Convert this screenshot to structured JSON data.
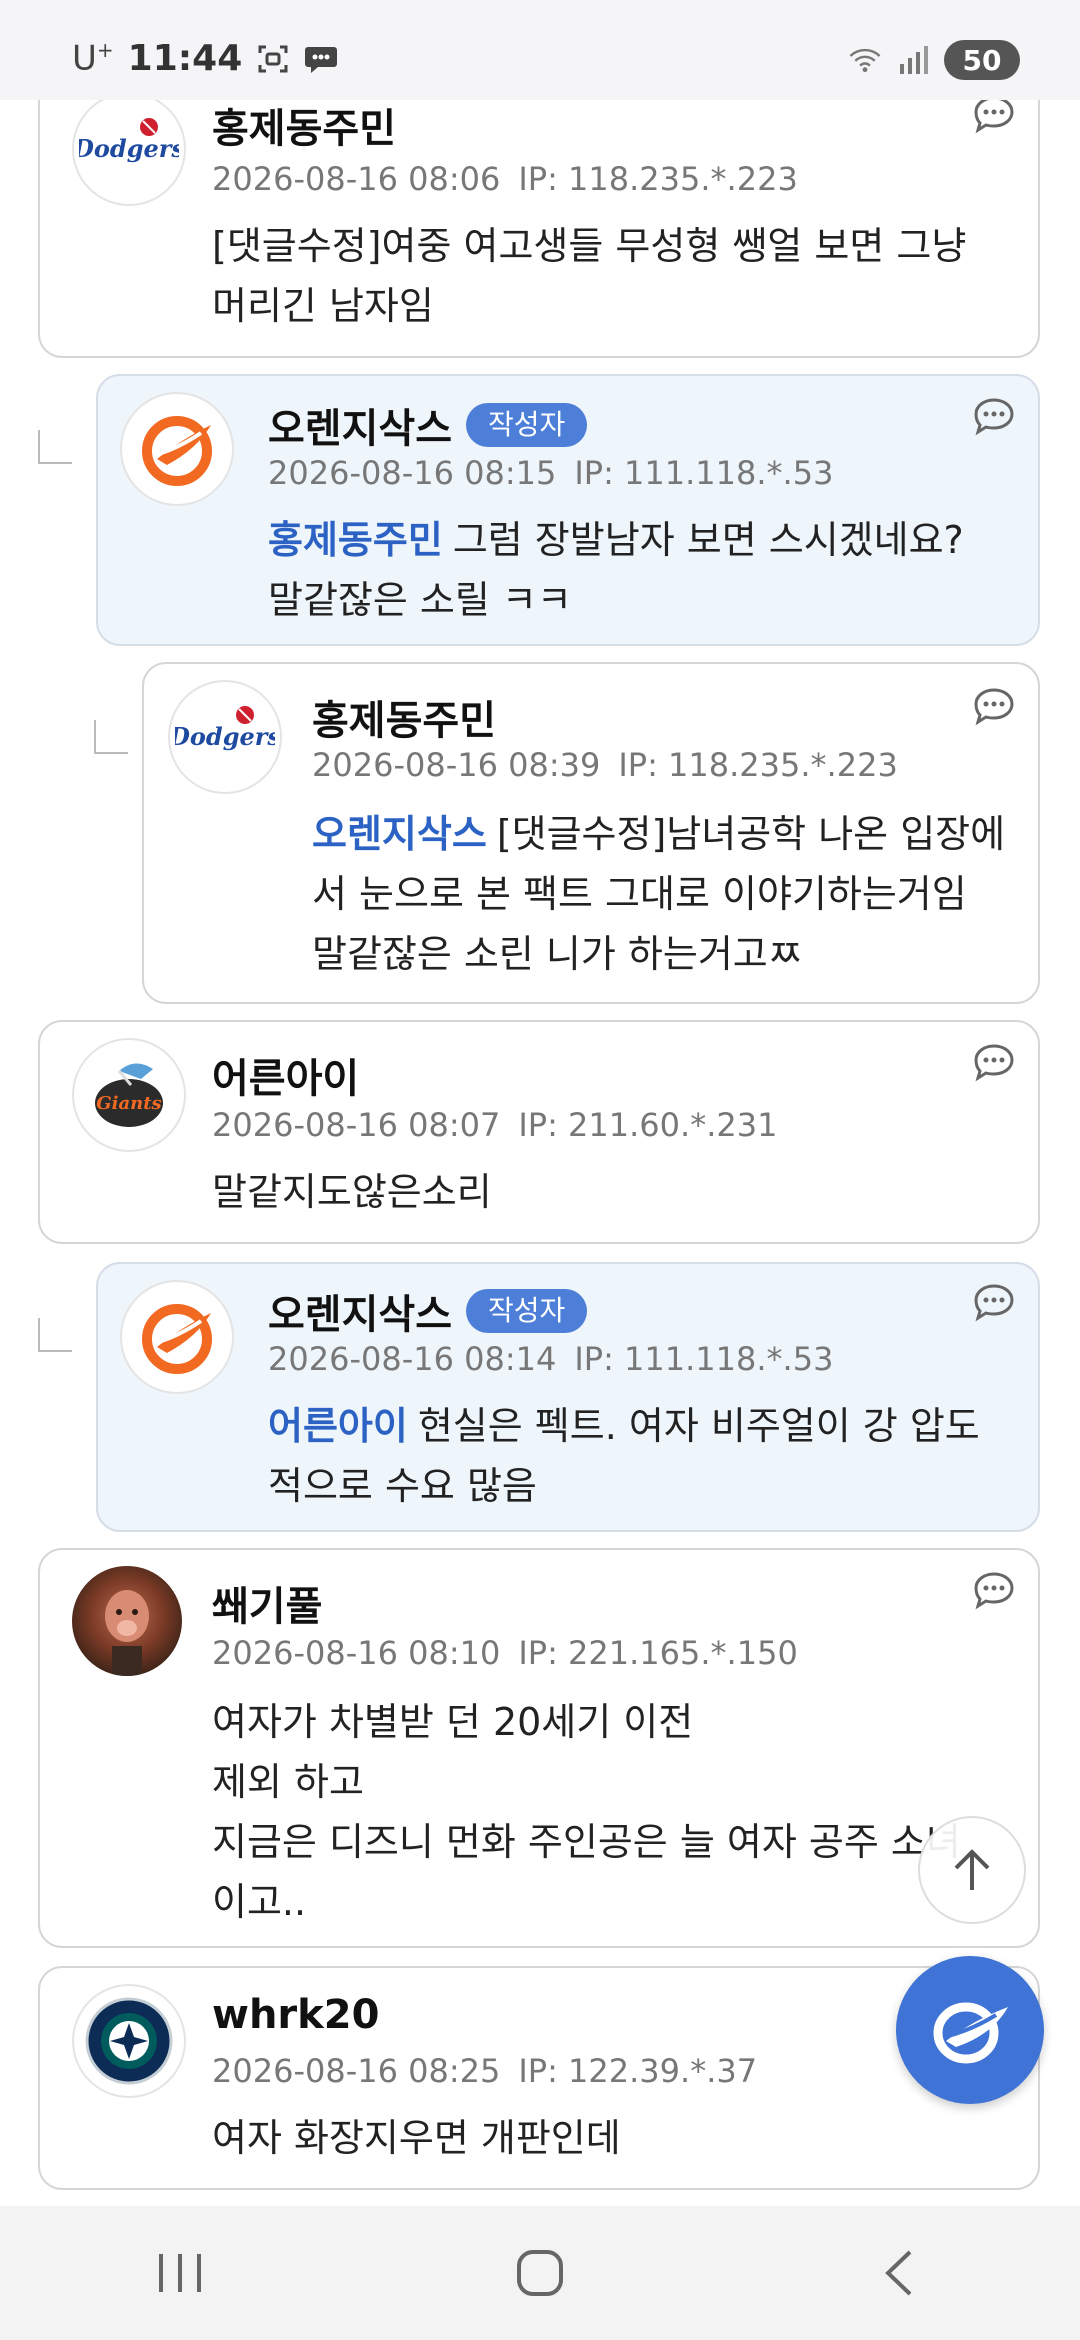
{
  "status_bar": {
    "carrier": "U",
    "carrier_sup": "+",
    "time": "11:44",
    "battery": "50",
    "icons": [
      "screenshot-icon",
      "chat-bubble-icon",
      "wifi-icon",
      "signal-icon"
    ]
  },
  "comments": [
    {
      "name": "홍제동주민",
      "date": "2026-08-16 08:06",
      "ip": "IP: 118.235.*.223",
      "body": "[댓글수정]여중 여고생들 무성형 쌩얼 보면 그냥 머리긴 남자임",
      "avatar": "dodgers-logo"
    },
    {
      "name": "오렌지삭스",
      "badge": "작성자",
      "date": "2026-08-16 08:15",
      "ip": "IP: 111.118.*.53",
      "mention": "홍제동주민",
      "body": "그럼 장발남자 보면 스시겠네요? 말같잖은 소릴 ㅋㅋ",
      "avatar": "eagles-logo"
    },
    {
      "name": "홍제동주민",
      "date": "2026-08-16 08:39",
      "ip": "IP: 118.235.*.223",
      "mention": "오렌지삭스",
      "body": "[댓글수정]남녀공학 나온 입장에서 눈으로 본 팩트 그대로 이야기하는거임 말같잖은 소린 니가 하는거고ㅉ",
      "avatar": "dodgers-logo"
    },
    {
      "name": "어른아이",
      "date": "2026-08-16 08:07",
      "ip": "IP: 211.60.*.231",
      "body": "말같지도않은소리",
      "avatar": "giants-logo"
    },
    {
      "name": "오렌지삭스",
      "badge": "작성자",
      "date": "2026-08-16 08:14",
      "ip": "IP: 111.118.*.53",
      "mention": "어른아이",
      "body": "현실은 펙트. 여자 비주얼이 강 압도적으로 수요 많음",
      "avatar": "eagles-logo"
    },
    {
      "name": "쐐기풀",
      "date": "2026-08-16 08:10",
      "ip": "IP: 221.165.*.150",
      "body_lines": [
        "여자가 차별받 던 20세기 이전",
        "제외 하고",
        "지금은 디즈니 먼화 주인공은 늘 여자 공주 소녀",
        "이고.."
      ],
      "avatar": "lion-photo"
    },
    {
      "name": "whrk20",
      "date": "2026-08-16 08:25",
      "ip": "IP: 122.39.*.37",
      "body": "여자 화장지우면 개판인데",
      "avatar": "mariners-logo"
    }
  ],
  "colors": {
    "accent": "#3f74d6",
    "mention": "#2b62c4",
    "badge": "#4d7fd8",
    "reply_bg": "#eef5fb",
    "eagles_orange": "#f26a22"
  },
  "nav": [
    "recent-apps-icon",
    "home-icon",
    "back-icon"
  ]
}
